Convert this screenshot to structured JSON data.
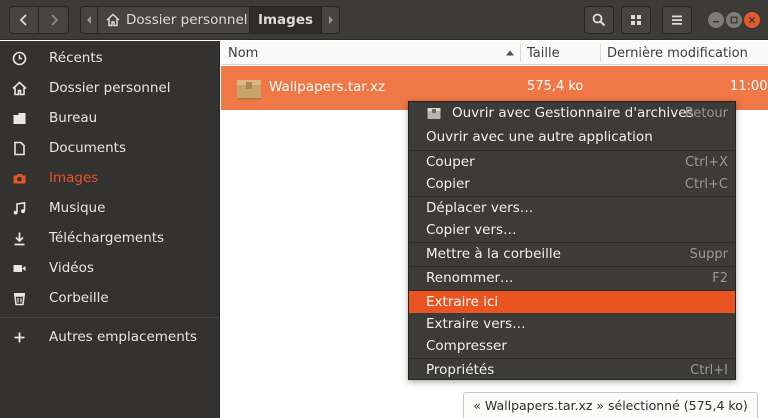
{
  "header": {
    "path": [
      {
        "label": "Dossier personnel"
      },
      {
        "label": "Images"
      }
    ],
    "icons": {
      "back": "chevron-left-icon",
      "forward": "chevron-right-icon",
      "search": "search-icon",
      "view": "grid-view-icon",
      "menu": "hamburger-menu-icon"
    }
  },
  "sidebar": {
    "items": [
      {
        "label": "Récents",
        "icon": "clock-icon"
      },
      {
        "label": "Dossier personnel",
        "icon": "home-icon"
      },
      {
        "label": "Bureau",
        "icon": "desktop-folder-icon"
      },
      {
        "label": "Documents",
        "icon": "document-icon"
      },
      {
        "label": "Images",
        "icon": "camera-icon",
        "active": true
      },
      {
        "label": "Musique",
        "icon": "music-icon"
      },
      {
        "label": "Téléchargements",
        "icon": "download-icon"
      },
      {
        "label": "Vidéos",
        "icon": "video-icon"
      },
      {
        "label": "Corbeille",
        "icon": "trash-icon"
      },
      {
        "label": "Autres emplacements",
        "icon": "plus-icon"
      }
    ]
  },
  "list": {
    "columns": {
      "name": "Nom",
      "size": "Taille",
      "modified": "Dernière modification"
    },
    "files": [
      {
        "name": "Wallpapers.tar.xz",
        "size": "575,4 ko",
        "modified": "11:00",
        "selected": true
      }
    ]
  },
  "context_menu": {
    "items": [
      {
        "label": "Ouvrir avec Gestionnaire d'archives",
        "shortcut": "Retour"
      },
      {
        "label": "Ouvrir avec une autre application",
        "shortcut": ""
      },
      {
        "label": "Couper",
        "shortcut": "Ctrl+X"
      },
      {
        "label": "Copier",
        "shortcut": "Ctrl+C"
      },
      {
        "label": "Déplacer vers…",
        "shortcut": ""
      },
      {
        "label": "Copier vers…",
        "shortcut": ""
      },
      {
        "label": "Mettre à la corbeille",
        "shortcut": "Suppr"
      },
      {
        "label": "Renommer…",
        "shortcut": "F2"
      },
      {
        "label": "Extraire ici",
        "shortcut": "",
        "highlighted": true
      },
      {
        "label": "Extraire vers…",
        "shortcut": ""
      },
      {
        "label": "Compresser",
        "shortcut": ""
      },
      {
        "label": "Propriétés",
        "shortcut": "Ctrl+I"
      }
    ]
  },
  "status": {
    "text": "« Wallpapers.tar.xz » sélectionné  (575,4 ko)"
  },
  "colors": {
    "accent": "#e95420",
    "selection": "#f07746",
    "sidebar_bg": "#333230",
    "header_bg": "#3c3b37",
    "menu_bg": "#3c3b37"
  }
}
